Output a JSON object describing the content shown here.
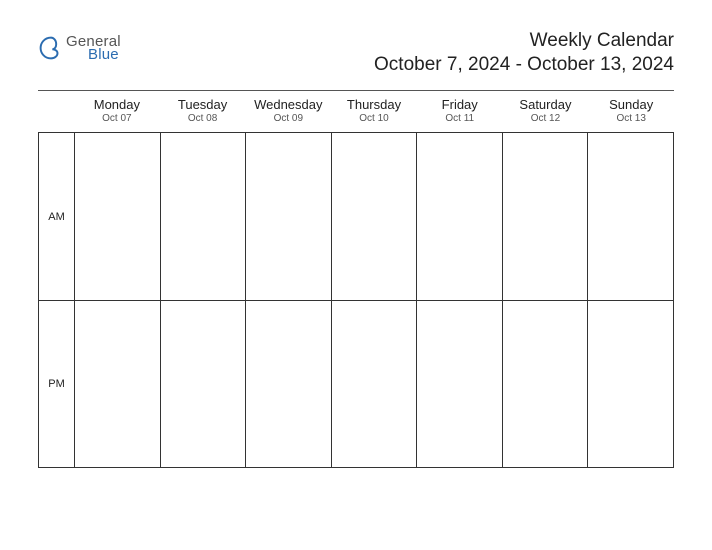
{
  "logo": {
    "line1": "General",
    "line2": "Blue"
  },
  "title": {
    "main": "Weekly Calendar",
    "range": "October 7, 2024 - October 13, 2024"
  },
  "days": [
    {
      "name": "Monday",
      "date": "Oct 07"
    },
    {
      "name": "Tuesday",
      "date": "Oct 08"
    },
    {
      "name": "Wednesday",
      "date": "Oct 09"
    },
    {
      "name": "Thursday",
      "date": "Oct 10"
    },
    {
      "name": "Friday",
      "date": "Oct 11"
    },
    {
      "name": "Saturday",
      "date": "Oct 12"
    },
    {
      "name": "Sunday",
      "date": "Oct 13"
    }
  ],
  "periods": [
    {
      "label": "AM"
    },
    {
      "label": "PM"
    }
  ]
}
